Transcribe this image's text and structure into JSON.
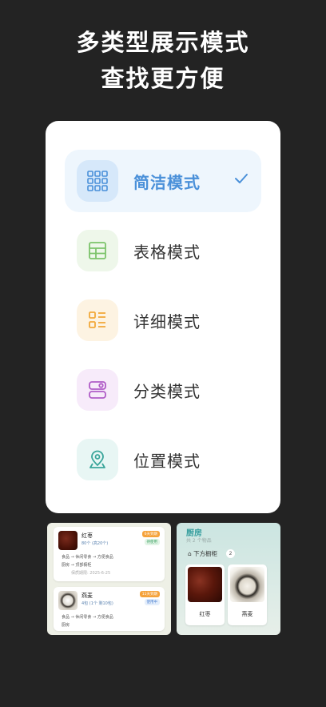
{
  "headline": {
    "line1": "多类型展示模式",
    "line2": "查找更方便"
  },
  "modes": [
    {
      "label": "简洁模式",
      "icon": "grid-icon",
      "selected": true,
      "color": "#4a90d9"
    },
    {
      "label": "表格模式",
      "icon": "table-icon",
      "selected": false,
      "color": "#7cc36b"
    },
    {
      "label": "详细模式",
      "icon": "detail-list-icon",
      "selected": false,
      "color": "#f2a93b"
    },
    {
      "label": "分类模式",
      "icon": "category-icon",
      "selected": false,
      "color": "#b05cc7"
    },
    {
      "label": "位置模式",
      "icon": "location-pin-icon",
      "selected": false,
      "color": "#3aa59a"
    }
  ],
  "preview_left": {
    "items": [
      {
        "name": "红枣",
        "sub": "80个 (高20个)",
        "tag1": "6天到期",
        "tag2": "待使用",
        "path": "食品 → 休闲零食 → 方便食品",
        "location": "厨房 → 顶部橱柜",
        "expiry": "保质期限: 2025-6-25"
      },
      {
        "name": "燕麦",
        "sub": "4包 (1个 剩10包)",
        "tag1": "11天到期",
        "tag2": "使用中",
        "path": "食品 → 休闲零食 → 方便食品",
        "location": "厨房"
      }
    ]
  },
  "preview_right": {
    "room": "厨房",
    "count": "共 2 个物品",
    "cabinet": "下方橱柜",
    "cabinet_count": "2",
    "tiles": [
      "红枣",
      "燕麦"
    ]
  }
}
